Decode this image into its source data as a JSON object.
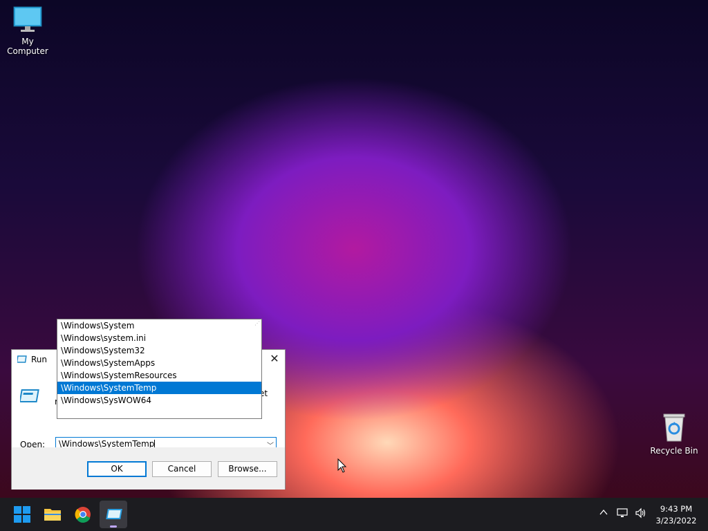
{
  "desktop": {
    "icons": [
      {
        "label": "My Computer",
        "icon": "monitor-icon"
      },
      {
        "label": "Recycle Bin",
        "icon": "recycle-bin-icon"
      }
    ]
  },
  "run_dialog": {
    "title": "Run",
    "description_left": "T",
    "description_left_line2": "r",
    "description_right": "et",
    "open_label": "Open:",
    "open_value": "\\Windows\\SystemTemp",
    "ok_label": "OK",
    "cancel_label": "Cancel",
    "browse_label": "Browse..."
  },
  "suggestions": {
    "items": [
      "\\Windows\\System",
      "\\Windows\\system.ini",
      "\\Windows\\System32",
      "\\Windows\\SystemApps",
      "\\Windows\\SystemResources",
      "\\Windows\\SystemTemp",
      "\\Windows\\SysWOW64"
    ],
    "selected_index": 5
  },
  "taskbar": {
    "apps": [
      "start",
      "file-explorer",
      "chrome",
      "run"
    ],
    "active_app": "run"
  },
  "clock": {
    "time": "9:43 PM",
    "date": "3/23/2022"
  },
  "colors": {
    "accent": "#0078d4",
    "taskbar": "#1c1c20"
  }
}
